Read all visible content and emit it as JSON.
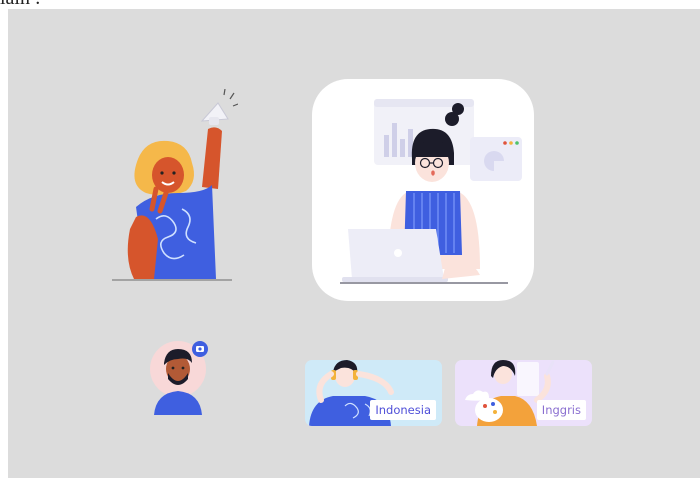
{
  "page": {
    "top_text": "lain :"
  },
  "colors": {
    "stage_bg": "#dcdcdc",
    "card_bg": "#ffffff",
    "accent_blue": "#3f5fe0",
    "orange_skin": "#d6552c",
    "hair_yellow": "#f5b84a",
    "indonesia_card_bg": "#cfeaf8",
    "inggris_card_bg": "#ece1fb",
    "label_text": "#4f4fd8"
  },
  "cards": [
    {
      "id": "indonesia",
      "label": "Indonesia"
    },
    {
      "id": "inggris",
      "label": "Inggris"
    }
  ],
  "icons": {
    "megaphone": "megaphone-icon",
    "camera": "camera-icon",
    "laptop": "laptop-icon"
  }
}
